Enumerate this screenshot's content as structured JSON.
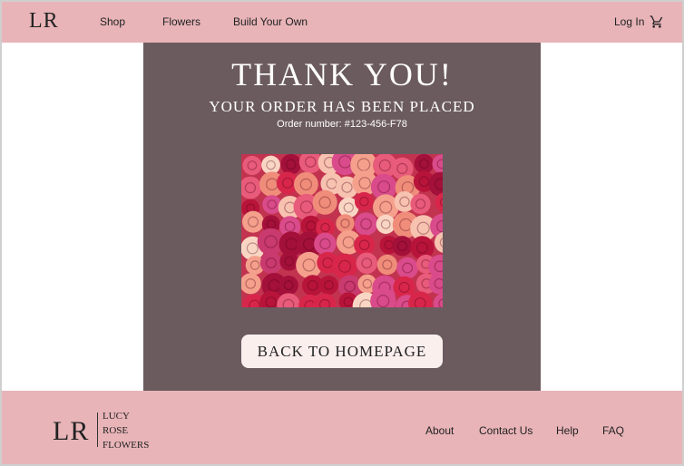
{
  "header": {
    "logo": "LR",
    "nav": {
      "shop": "Shop",
      "flowers": "Flowers",
      "build_your_own": "Build Your Own"
    },
    "login": "Log In",
    "cart_icon": "shopping-cart-icon"
  },
  "main": {
    "title": "THANK YOU!",
    "subtitle": "YOUR ORDER HAS BEEN PLACED",
    "order_number": "Order number: #123-456-F78",
    "image": "roses-wall-image",
    "back_button": "BACK TO HOMEPAGE"
  },
  "footer": {
    "logo": "LR",
    "brand_lines": [
      "LUCY",
      "ROSE",
      "FLOWERS"
    ],
    "links": {
      "about": "About",
      "contact": "Contact Us",
      "help": "Help",
      "faq": "FAQ"
    }
  },
  "colors": {
    "header_bg": "#e8b4b8",
    "panel_bg": "#6b5b5f",
    "button_bg": "#fbefee",
    "text_dark": "#222222"
  }
}
